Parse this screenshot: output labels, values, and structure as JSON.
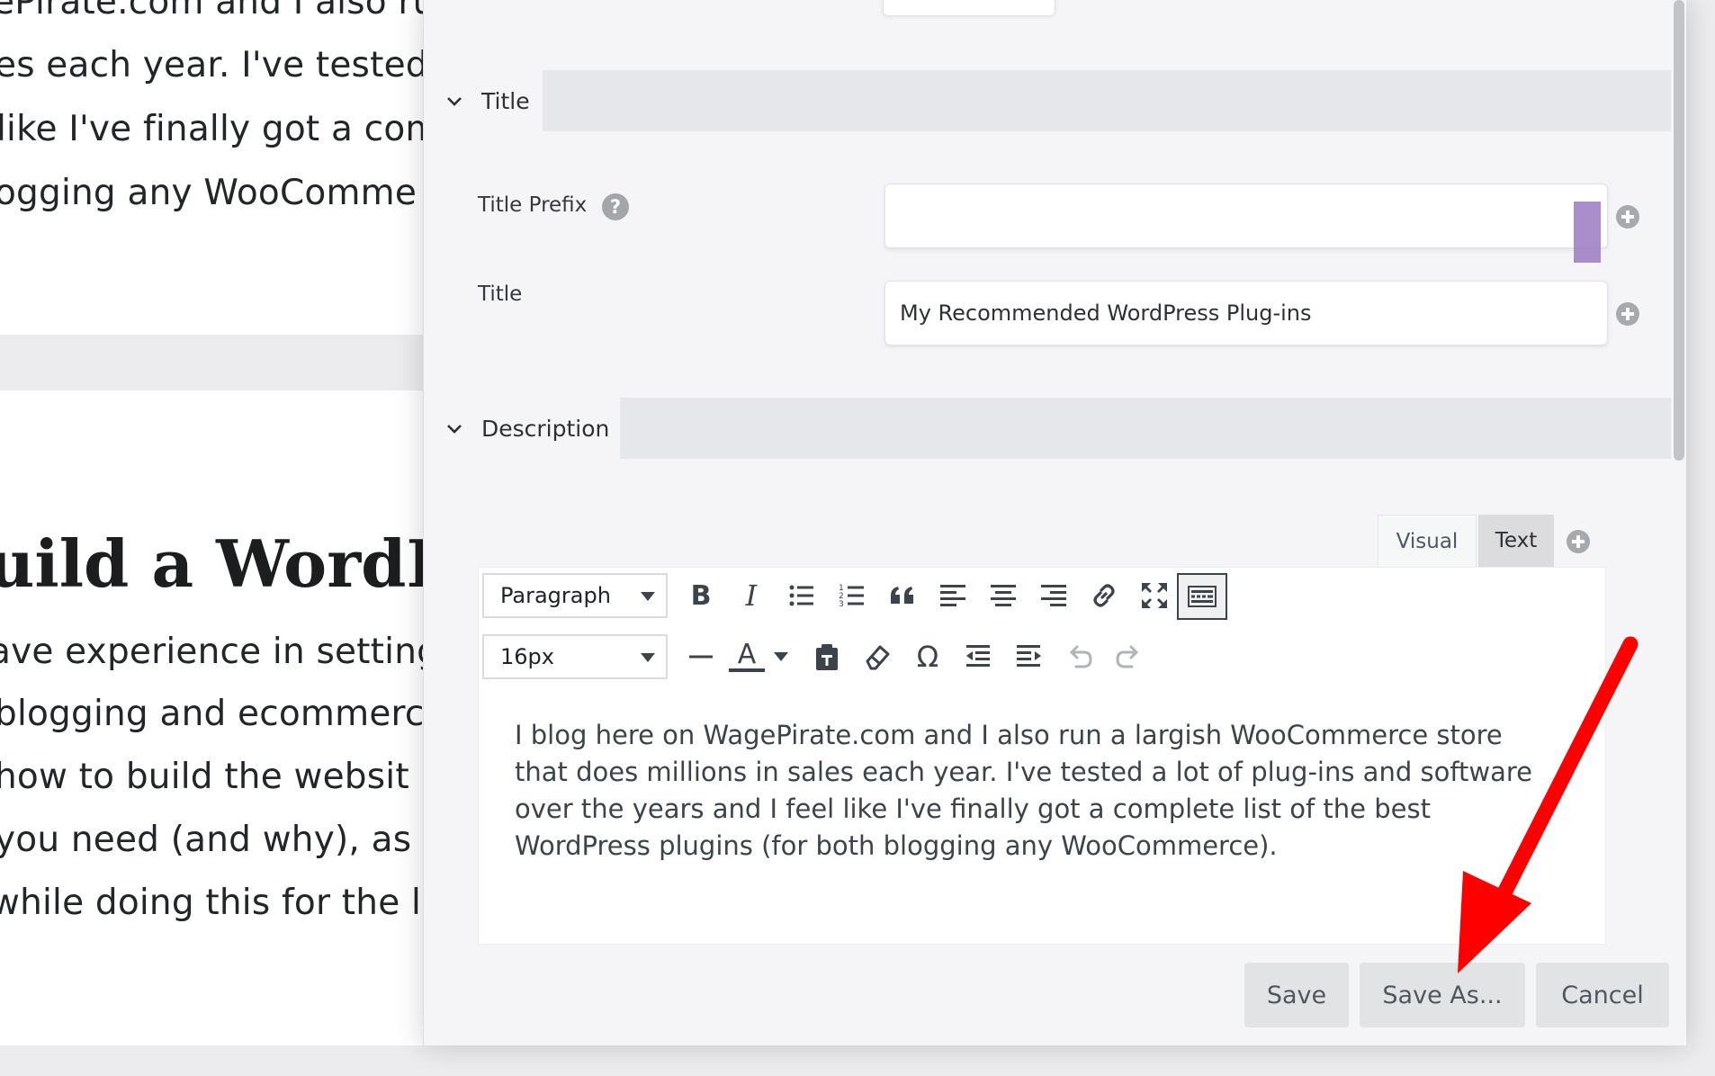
{
  "background_page": {
    "top_lines": [
      "ePirate.com and I also ru",
      "es each year. I've tested",
      "like I've finally got a com",
      "ogging any WooComme"
    ],
    "heading": "uild a WordPre",
    "bottom_lines": [
      "ave experience in setting",
      " blogging and ecommerc",
      " how to build the websit",
      " you need (and why), as",
      "while doing this for the la"
    ]
  },
  "panel": {
    "sections": {
      "title": {
        "label": "Title"
      },
      "description": {
        "label": "Description"
      }
    },
    "fields": {
      "title_prefix": {
        "label": "Title Prefix",
        "help": "?",
        "value": ""
      },
      "title": {
        "label": "Title",
        "value": "My Recommended WordPress Plug-ins"
      }
    },
    "editor": {
      "tabs": {
        "visual": "Visual",
        "text": "Text"
      },
      "format_select": "Paragraph",
      "size_select": "16px",
      "toolbar_glyphs": {
        "bold": "B",
        "italic": "I",
        "omega": "Ω",
        "text_color": "A"
      },
      "content": "I blog here on WagePirate.com and I also run a largish WooCommerce store that does millions in sales each year. I've tested a lot of plug-ins and software over the years and I feel like I've finally got a complete list of the best WordPress plugins (for both blogging any WooCommerce)."
    },
    "buttons": {
      "save": "Save",
      "save_as": "Save As...",
      "cancel": "Cancel"
    }
  },
  "colors": {
    "annotation_arrow": "#ff0000",
    "connection_marker": "#9b7ac2"
  }
}
